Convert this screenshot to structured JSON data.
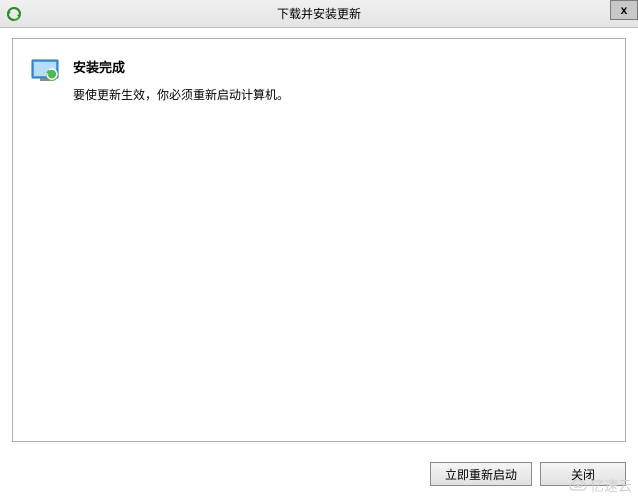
{
  "window": {
    "title": "下载并安装更新",
    "close_label": "x"
  },
  "content": {
    "heading": "安装完成",
    "subtext": "要使更新生效，你必须重新启动计算机。"
  },
  "buttons": {
    "restart_now": "立即重新启动",
    "close": "关闭"
  },
  "watermark": {
    "text": "亿速云"
  }
}
